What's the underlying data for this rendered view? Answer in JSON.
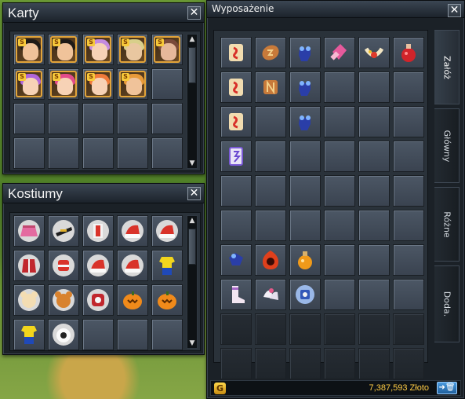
{
  "windows": {
    "karty": {
      "title": "Karty",
      "close": "✕"
    },
    "kostiumy": {
      "title": "Kostiumy",
      "close": "✕"
    },
    "wyposazenie": {
      "title": "Wyposażenie",
      "close": "✕",
      "tabs": [
        {
          "label": "Załóż",
          "active": true
        },
        {
          "label": "Główny",
          "active": false
        },
        {
          "label": "Różne",
          "active": false
        },
        {
          "label": "Doda.",
          "active": false
        }
      ],
      "gold_icon": "G",
      "gold_amount": "7,387,593 Złoto",
      "trash_icon": "➜🗑"
    }
  },
  "card_badge": "S",
  "colors": {
    "gold_text": "#ffcc44",
    "card_border": "#e2a43a",
    "window_bg": "#1b2127"
  }
}
